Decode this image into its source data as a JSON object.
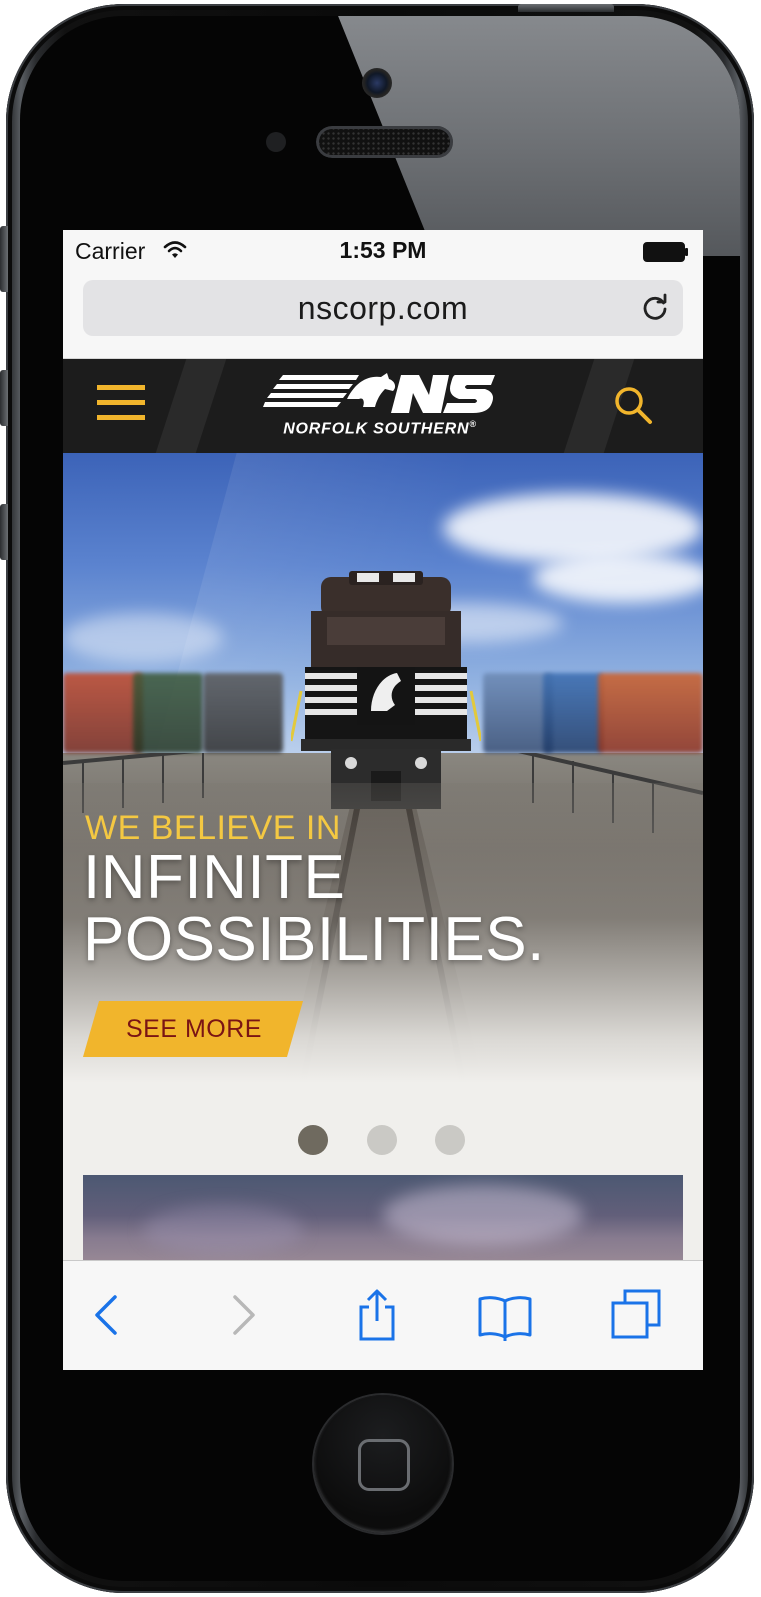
{
  "status_bar": {
    "carrier": "Carrier",
    "time": "1:53 PM",
    "icons": [
      "wifi-icon",
      "battery-icon"
    ]
  },
  "browser": {
    "url": "nscorp.com",
    "reload_icon": "reload-icon",
    "toolbar": {
      "icons": [
        "back-icon",
        "forward-icon",
        "share-icon",
        "bookmarks-icon",
        "tabs-icon"
      ],
      "forward_disabled": true,
      "accent_color": "#1a73e8",
      "disabled_color": "#b8b8b8"
    }
  },
  "site": {
    "header": {
      "menu_icon": "hamburger-menu-icon",
      "logo_text": "NORFOLK SOUTHERN",
      "logo_trademark": "®",
      "search_icon": "search-icon",
      "background_color": "#1c1c1c",
      "accent_color": "#f1b52c"
    },
    "hero": {
      "kicker": "WE BELIEVE IN",
      "title_line1": "INFINITE",
      "title_line2": "POSSIBILITIES.",
      "cta_label": "SEE MORE",
      "kicker_color": "#f4c842",
      "cta_color": "#f1b52c",
      "cta_text_color": "#7a1414"
    },
    "carousel": {
      "slide_count": 3,
      "active_index": 0
    }
  },
  "device": {
    "type": "iPhone",
    "home_button_icon": "home-button-icon"
  }
}
